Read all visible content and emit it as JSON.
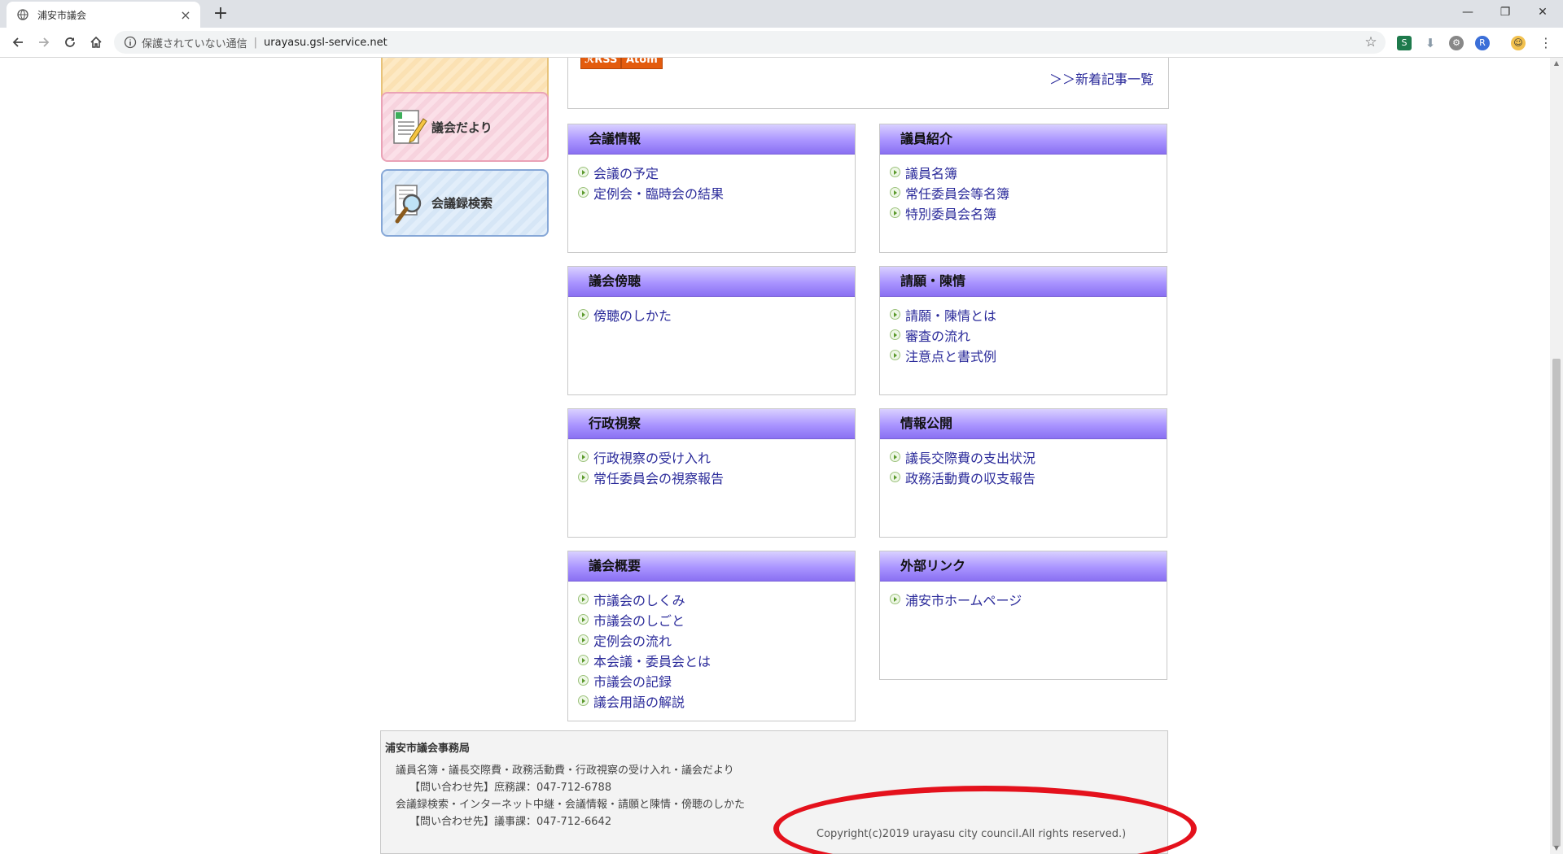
{
  "browser": {
    "tab_title": "浦安市議会",
    "security_label": "保護されていない通信",
    "separator": "|",
    "url": "urayasu.gsl-service.net"
  },
  "sidebar": {
    "news_label": "議会だより",
    "search_label": "会議録検索"
  },
  "feeds": {
    "rss_label": "RSS",
    "atom_label": "Atom",
    "more_link": "＞＞新着記事一覧"
  },
  "sections": [
    {
      "title": "会議情報",
      "links": [
        "会議の予定",
        "定例会・臨時会の結果"
      ]
    },
    {
      "title": "議員紹介",
      "links": [
        "議員名簿",
        "常任委員会等名簿",
        "特別委員会名簿"
      ]
    },
    {
      "title": "議会傍聴",
      "links": [
        "傍聴のしかた"
      ]
    },
    {
      "title": "請願・陳情",
      "links": [
        "請願・陳情とは",
        "審査の流れ",
        "注意点と書式例"
      ]
    },
    {
      "title": "行政視察",
      "links": [
        "行政視察の受け入れ",
        "常任委員会の視察報告"
      ]
    },
    {
      "title": "情報公開",
      "links": [
        "議長交際費の支出状況",
        "政務活動費の収支報告"
      ]
    },
    {
      "title": "議会概要",
      "links": [
        "市議会のしくみ",
        "市議会のしごと",
        "定例会の流れ",
        "本会議・委員会とは",
        "市議会の記録",
        "議会用語の解説"
      ]
    },
    {
      "title": "外部リンク",
      "links": [
        "浦安市ホームページ"
      ]
    }
  ],
  "footer": {
    "title": "浦安市議会事務局",
    "line1": "議員名簿・議長交際費・政務活動費・行政視察の受け入れ・議会だより",
    "line2": "【問い合わせ先】庶務課：047-712-6788",
    "line3": "会議録検索・インターネット中継・会議情報・請願と陳情・傍聴のしかた",
    "line4": "【問い合わせ先】議事課：047-712-6642",
    "copyright": "Copyright(c)2019 urayasu city council.All rights reserved.)"
  },
  "colors": {
    "link": "#2a2a9a",
    "header_purple": "#a994ff",
    "feed_orange": "#e35b0d",
    "highlight_ring": "#e4111c"
  }
}
